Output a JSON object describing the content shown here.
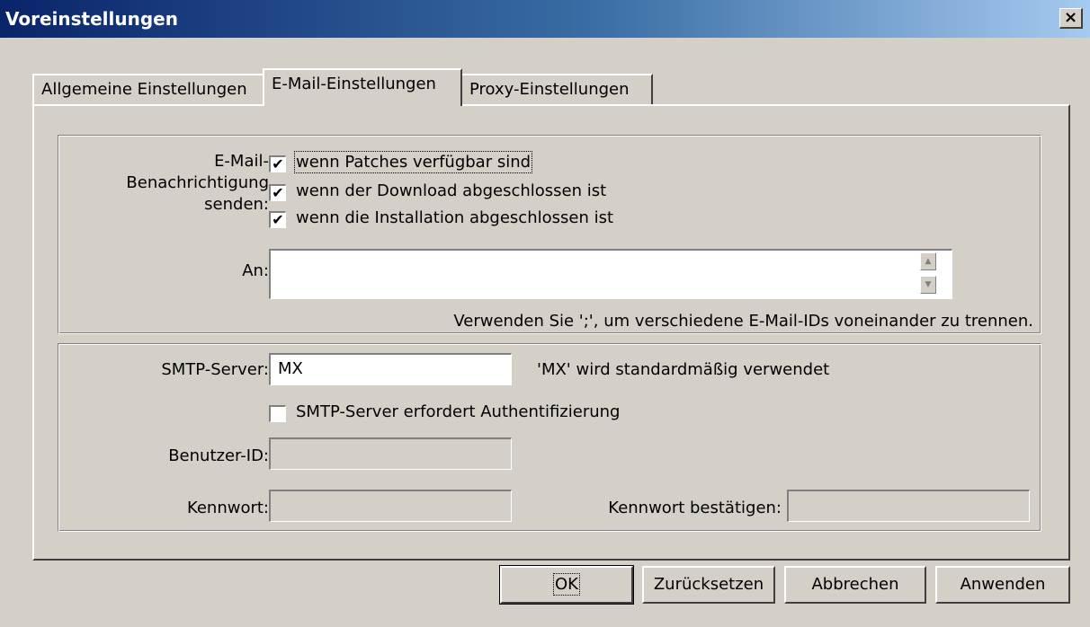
{
  "window": {
    "title": "Voreinstellungen",
    "close_label": "×"
  },
  "tabs": [
    {
      "label": "Allgemeine Einstellungen",
      "active": false
    },
    {
      "label": "E-Mail-Einstellungen",
      "active": true
    },
    {
      "label": "Proxy-Einstellungen",
      "active": false
    }
  ],
  "notify": {
    "label_line1": "E-Mail-",
    "label_line2": "Benachrichtigung",
    "label_line3": "senden:",
    "options": [
      {
        "label": "wenn Patches verfügbar sind",
        "checked": true
      },
      {
        "label": "wenn der Download abgeschlossen ist",
        "checked": true
      },
      {
        "label": "wenn die Installation abgeschlossen ist",
        "checked": true
      }
    ],
    "to_label": "An:",
    "to_value": "",
    "hint": "Verwenden Sie ';', um verschiedene E-Mail-IDs voneinander zu trennen."
  },
  "smtp": {
    "server_label": "SMTP-Server:",
    "server_value": "MX",
    "server_hint": "'MX' wird standardmäßig verwendet",
    "auth_label": "SMTP-Server erfordert Authentifizierung",
    "auth_checked": false,
    "user_label": "Benutzer-ID:",
    "user_value": "",
    "password_label": "Kennwort:",
    "password_value": "",
    "confirm_label": "Kennwort bestätigen:",
    "confirm_value": ""
  },
  "buttons": {
    "ok": "OK",
    "reset": "Zurücksetzen",
    "cancel": "Abbrechen",
    "apply": "Anwenden"
  },
  "icons": {
    "check": "✔",
    "scroll_up": "▲",
    "scroll_down": "▼"
  }
}
